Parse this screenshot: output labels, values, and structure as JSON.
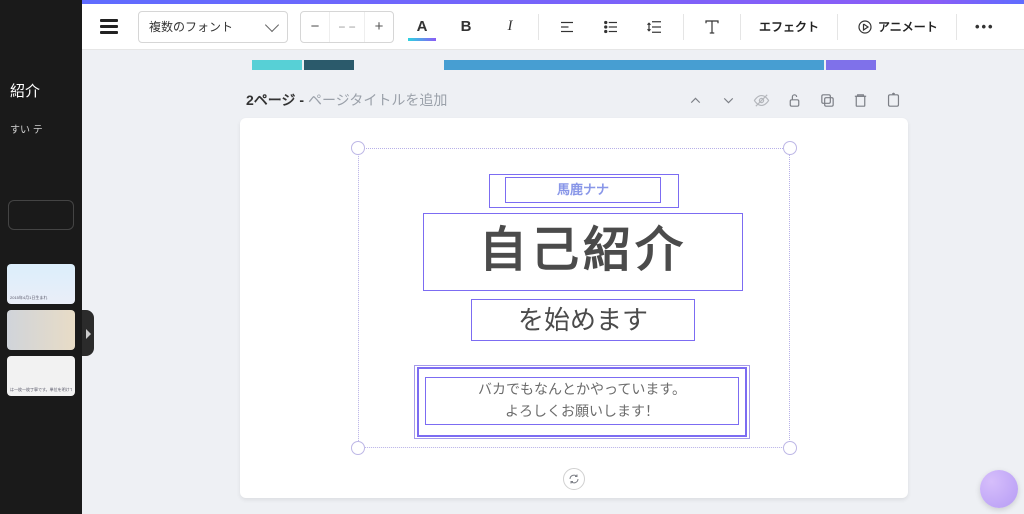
{
  "sidebar": {
    "title_fragment": "紹介",
    "desc_fragment": "すい テ",
    "thumbs": [
      {
        "caption": "2015年4月1日生まれ"
      },
      {
        "caption": ""
      },
      {
        "caption": "は一枚一枚丁寧です。単位を明けて、今もよく。おはし・続けています。"
      }
    ]
  },
  "toolbar": {
    "font_label": "複数のフォント",
    "size_minus": "−",
    "size_value": "− −",
    "size_plus": "+",
    "color_letter": "A",
    "bold": "B",
    "italic": "I",
    "effects": "エフェクト",
    "animate": "アニメート",
    "more": "•••"
  },
  "page_header": {
    "page_num": "2ページ",
    "sep": " - ",
    "hint": "ページタイトルを追加"
  },
  "slide": {
    "name": "馬鹿ナナ",
    "heading": "自己紹介",
    "subheading": "を始めます",
    "paragraph_line1": "バカでもなんとかやっています。",
    "paragraph_line2": "よろしくお願いします！"
  },
  "colors": {
    "selection": "#7c6cf2",
    "canvas_bg": "#eef0f4",
    "dark": "#1a1a1a"
  }
}
